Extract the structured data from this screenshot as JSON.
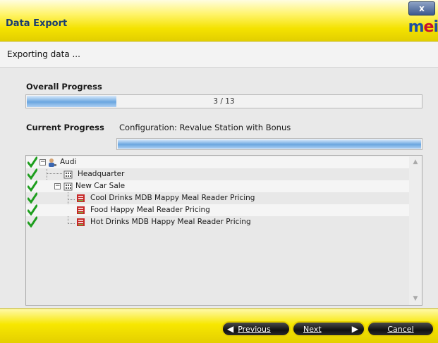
{
  "window": {
    "title": "Data Export",
    "close_label": "x",
    "logo_text_1": "m",
    "logo_text_2": "e",
    "logo_text_3": "i"
  },
  "header": {
    "subtitle": "Exporting data ..."
  },
  "overall": {
    "label": "Overall Progress",
    "progress_text": "3 / 13",
    "progress_fraction": 0.23
  },
  "current": {
    "label": "Current Progress",
    "configuration_text": "Configuration: Revalue Station with Bonus",
    "progress_fraction": 1.0
  },
  "tree": {
    "items": [
      {
        "label": "Audi",
        "icon": "user-group-icon",
        "checked": true
      },
      {
        "label": "Headquarter",
        "icon": "building-icon",
        "checked": true
      },
      {
        "label": "New Car Sale",
        "icon": "building-icon",
        "checked": true
      },
      {
        "label": "Cool Drinks MDB Mappy Meal Reader Pricing",
        "icon": "config-document-icon",
        "checked": true
      },
      {
        "label": "Food Happy Meal Reader Pricing",
        "icon": "config-document-icon",
        "checked": true
      },
      {
        "label": "Hot Drinks MDB Happy Meal Reader Pricing",
        "icon": "config-document-icon",
        "checked": true
      }
    ]
  },
  "footer": {
    "previous_label": "Previous",
    "next_label": "Next",
    "cancel_label": "Cancel"
  },
  "colors": {
    "accent_yellow": "#f4e200",
    "progress_blue": "#6aa6e0",
    "check_green": "#1e9e1e"
  }
}
